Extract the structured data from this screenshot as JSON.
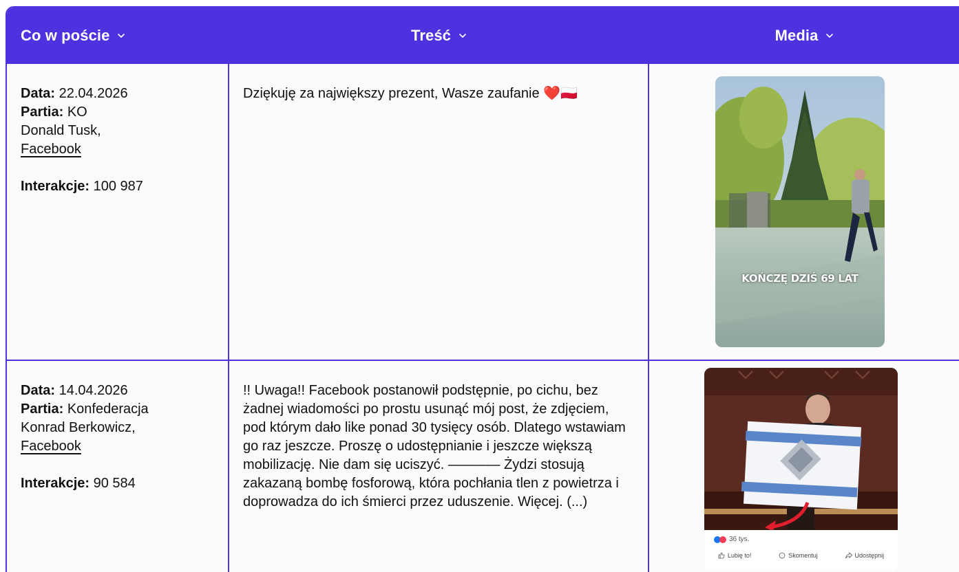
{
  "header": {
    "col1": "Co w poście",
    "col2": "Treść",
    "col3": "Media"
  },
  "labels": {
    "date": "Data:",
    "party": "Partia:",
    "interactions": "Interakcje:"
  },
  "rows": [
    {
      "date": "22.04.2026",
      "party": "KO",
      "author": "Donald Tusk,",
      "platform": "Facebook",
      "interactions": "100 987",
      "text": "Dziękuję za największy prezent, Wasze zaufanie ❤️🇵🇱",
      "media_caption": "KOŃCZĘ DZIŚ 69 LAT"
    },
    {
      "date": "14.04.2026",
      "party": "Konfederacja",
      "author": "Konrad Berkowicz,",
      "platform": "Facebook",
      "interactions": "90 584",
      "text": "!! Uwaga!! Facebook postanowił podstępnie, po cichu, bez żadnej wiadomości po prostu usunąć mój post, że zdjęciem, pod którym dało like ponad 30 tysięcy osób. Dlatego wstawiam go raz jeszcze. Proszę o udostępnianie i jeszcze większą mobilizację. Nie dam się uciszyć. —––––– Żydzi stosują zakazaną bombę fosforową, która pochłania tlen z powietrza i doprowadza do ich śmierci przez uduszenie. Więcej. (...)",
      "media_reactions": "36 tys.",
      "media_like": "Lubię to!",
      "media_comment": "Skomentuj",
      "media_share": "Udostępnij"
    }
  ],
  "colors": {
    "accent": "#4f31df",
    "header_text": "#ffffff",
    "body_bg": "#fbfbfd"
  }
}
